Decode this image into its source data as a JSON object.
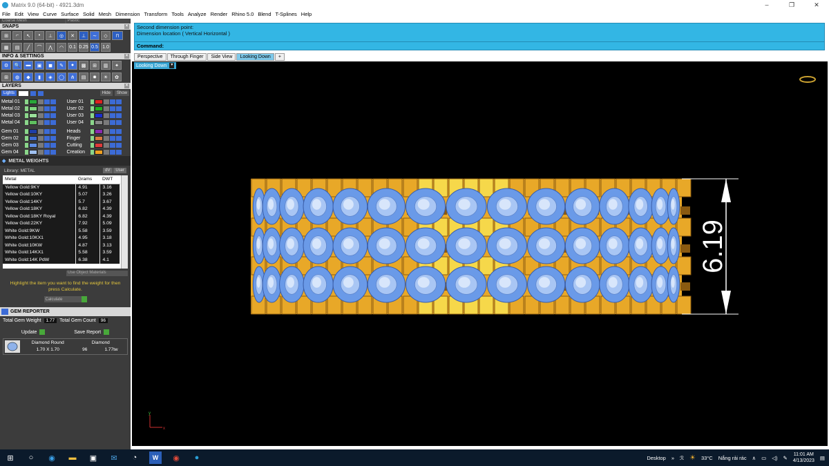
{
  "window": {
    "title": "Matrix 9.0 (64-bit) - 4921.3dm",
    "min": "–",
    "max": "❐",
    "close": "✕"
  },
  "menu": [
    "File",
    "Edit",
    "View",
    "Curve",
    "Surface",
    "Solid",
    "Mesh",
    "Dimension",
    "Transform",
    "Tools",
    "Analyze",
    "Render",
    "Rhino 5.0",
    "Blend",
    "T-Splines",
    "Help"
  ],
  "left": {
    "mesh_dropdown": "Coarse Mesh",
    "material_dropdown": "Plastic",
    "snaps_header": "SNAPS",
    "snap_values": [
      "0.1",
      "0.25",
      "0.5",
      "1.0"
    ],
    "info_header": "INFO & SETTINGS",
    "layers_header": "LAYERS",
    "lights_label": "Lights",
    "hide_label": "Hide",
    "show_label": "Show",
    "layers_left": [
      {
        "name": "Metal 01",
        "color": "#2aa63a"
      },
      {
        "name": "Metal 02",
        "color": "#7fd67f"
      },
      {
        "name": "Metal 03",
        "color": "#9be09b"
      },
      {
        "name": "Metal 04",
        "color": "#5fbf5f"
      }
    ],
    "layers_left2": [
      {
        "name": "Gem 01",
        "color": "#1f3fa8"
      },
      {
        "name": "Gem 02",
        "color": "#3f6fd8"
      },
      {
        "name": "Gem 03",
        "color": "#5f8fe8"
      },
      {
        "name": "Gem 04",
        "color": "#9fc0f0"
      }
    ],
    "layers_right": [
      {
        "name": "User 01",
        "color": "#e02020"
      },
      {
        "name": "User 02",
        "color": "#20b020"
      },
      {
        "name": "User 03",
        "color": "#1a2fd0"
      },
      {
        "name": "User 04",
        "color": "#888888"
      }
    ],
    "layers_right2": [
      {
        "name": "Heads",
        "color": "#8a2ab0"
      },
      {
        "name": "Finger",
        "color": "#d87a40"
      },
      {
        "name": "Cutting",
        "color": "#e03a3a"
      },
      {
        "name": "Creation",
        "color": "#f0a020"
      }
    ],
    "metal_weights": {
      "header": "METAL WEIGHTS",
      "library_label": "Library: METAL",
      "dv_label": "dV",
      "user_label": "User",
      "columns": [
        "Metal",
        "Grams",
        "DWT"
      ],
      "rows": [
        [
          "Yellow Gold:9KY",
          "4.91",
          "3.16"
        ],
        [
          "Yellow Gold:10KY",
          "5.07",
          "3.26"
        ],
        [
          "Yellow Gold:14KY",
          "5.7",
          "3.67"
        ],
        [
          "Yellow Gold:18KY",
          "6.82",
          "4.39"
        ],
        [
          "Yellow Gold:18KY Royal",
          "6.82",
          "4.39"
        ],
        [
          "Yellow Gold:22KY",
          "7.92",
          "5.09"
        ],
        [
          "White Gold:9KW",
          "5.58",
          "3.59"
        ],
        [
          "White Gold:10KX1",
          "4.95",
          "3.18"
        ],
        [
          "White Gold:10KW",
          "4.87",
          "3.13"
        ],
        [
          "White Gold:14KX1",
          "5.58",
          "3.59"
        ],
        [
          "White Gold:14K PdW",
          "6.38",
          "4.1"
        ]
      ],
      "use_object": "Use Object Materials",
      "hint": "Highlight the item you want to find the weight for then press Calculate.",
      "calculate": "Calculate"
    },
    "gem_reporter": {
      "header": "GEM REPORTER",
      "total_weight_label": "Total Gem Weight",
      "total_weight": "1.77",
      "total_count_label": "Total Gem Count",
      "total_count": "96",
      "update": "Update",
      "save_report": "Save Report",
      "gem_type": "Diamond Round",
      "gem_material": "Diamond",
      "gem_size": "1.70 X 1.70",
      "gem_count": "96",
      "gem_tw": "1.77tw"
    }
  },
  "command": {
    "history_1": "Second dimension point:",
    "history_2": "Dimension location ( Vertical  Horizontal )",
    "prompt": "Command:"
  },
  "tabs": [
    "Perspective",
    "Through Finger",
    "Side View",
    "Looking Down",
    "+"
  ],
  "active_tab": "Looking Down",
  "view_label": "Looking Down",
  "viewport": {
    "dimension_text": "6.19",
    "axis_y": "y",
    "axis_x": "x",
    "gold_light": "#f6d84a",
    "gold": "#e8a828",
    "gold_dark": "#8a5a10",
    "gem_blue": "#6a9ae8",
    "background": "#000000"
  },
  "taskbar": {
    "desktop": "Desktop",
    "temp": "33°C",
    "weather": "Nắng rải rác",
    "time": "11:01 AM",
    "date": "4/13/2023"
  }
}
